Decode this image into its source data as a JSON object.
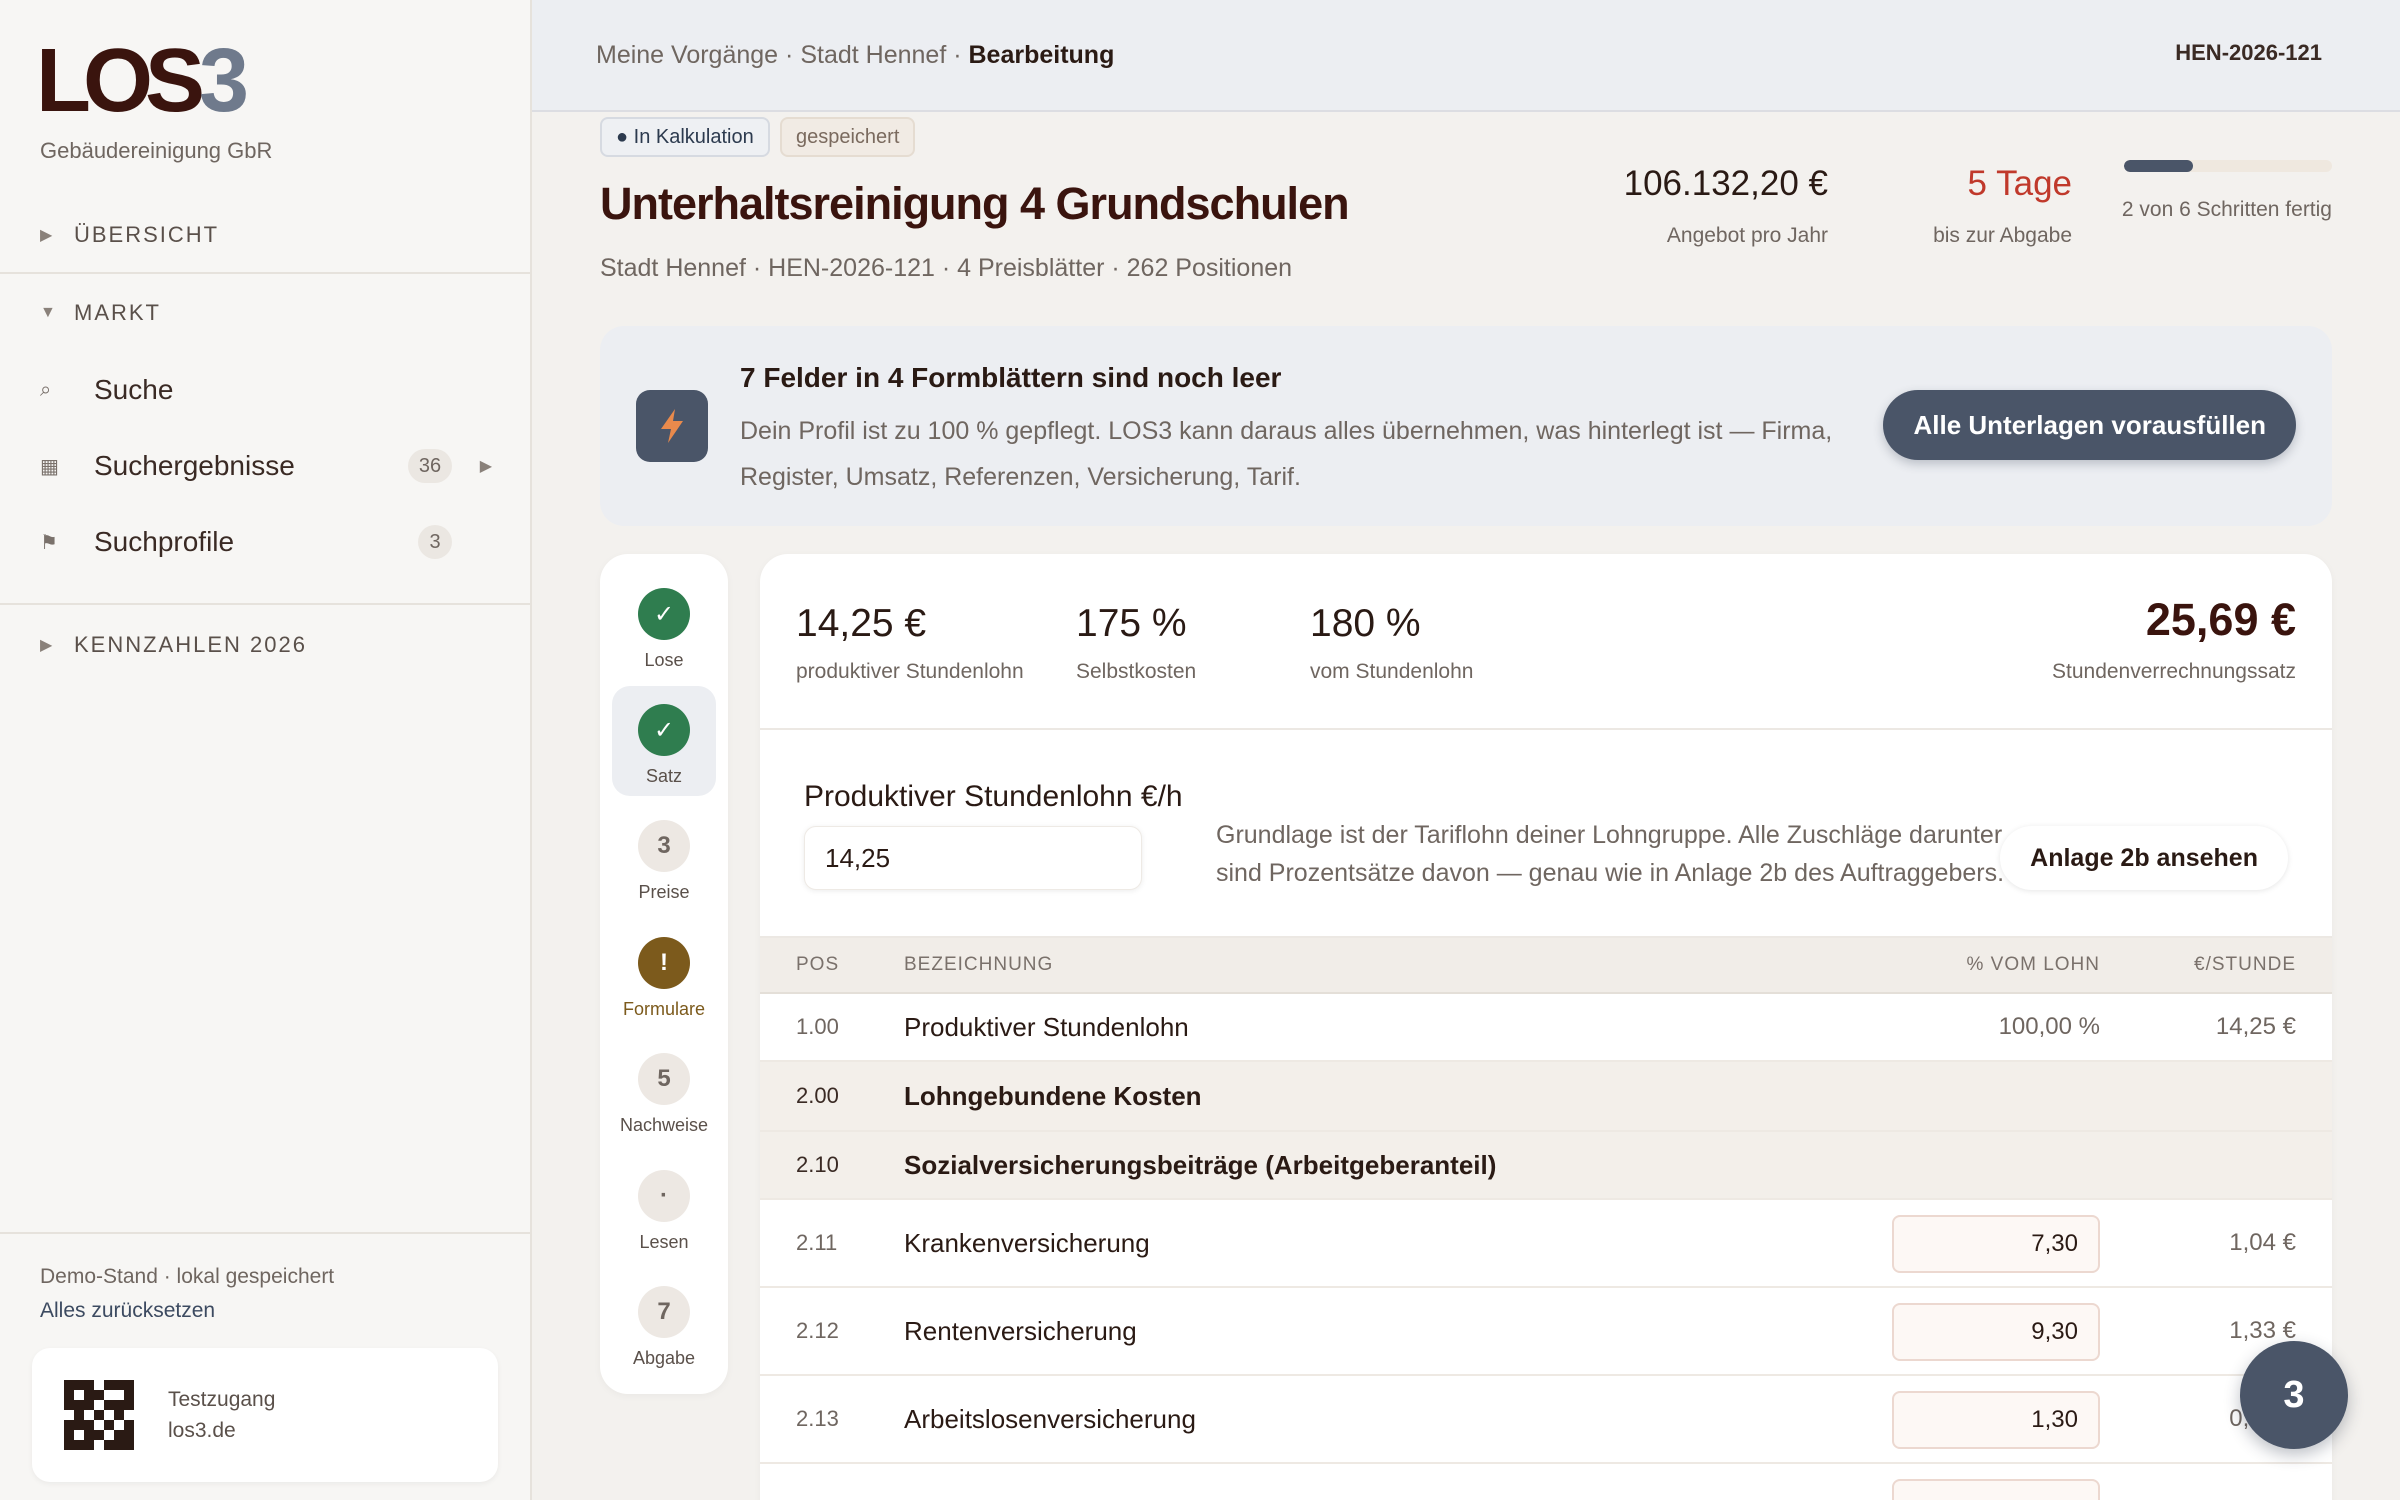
{
  "sidebar": {
    "logo_main": "LOS",
    "logo_digit": "3",
    "company": "Gebäudereinigung GbR",
    "sections": [
      {
        "label": "ÜBERSICHT"
      },
      {
        "label": "MARKT"
      },
      {
        "label": "KENNZAHLEN 2026"
      }
    ],
    "items": [
      {
        "label": "Suche",
        "icon": "search-icon"
      },
      {
        "label": "Suchergebnisse",
        "icon": "grid-icon",
        "badge": "36"
      },
      {
        "label": "Suchprofile",
        "icon": "flag-icon",
        "badge": "3"
      }
    ],
    "demo_status": "Demo-Stand · lokal gespeichert",
    "reset_label": "Alles zurücksetzen",
    "test_label": "Testzugang",
    "test_url": "los3.de"
  },
  "topbar": {
    "crumb_1": "Meine Vorgänge",
    "crumb_2": "Stadt Hennef",
    "crumb_current": "Bearbeitung",
    "separator": "·",
    "case_id": "HEN-2026-121"
  },
  "header": {
    "status_chip": "● In Kalkulation",
    "saved_chip": "gespeichert",
    "title": "Unterhaltsreinigung 4 Grundschulen",
    "subtitle": "Stadt Hennef · HEN-2026-121 · 4 Preisblätter · 262 Positionen",
    "offer_value": "106.132,20 €",
    "offer_label": "Angebot pro Jahr",
    "days_value": "5 Tage",
    "days_label": "bis zur Abgabe",
    "progress_fraction": 0.3333,
    "progress_label": "2 von 6 Schritten fertig"
  },
  "alert": {
    "icon": "lightning-icon",
    "title": "7 Felder in 4 Formblättern sind noch leer",
    "body": "Dein Profil ist zu 100 % gepflegt. LOS3 kann daraus alles übernehmen, was hinterlegt ist — Firma, Register, Umsatz, Referenzen, Versicherung, Tarif.",
    "button": "Alle Unterlagen vorausfüllen"
  },
  "steps": [
    {
      "mark": "✓",
      "label": "Lose",
      "state": "done"
    },
    {
      "mark": "✓",
      "label": "Satz",
      "state": "done-active"
    },
    {
      "mark": "3",
      "label": "Preise",
      "state": "todo"
    },
    {
      "mark": "!",
      "label": "Formulare",
      "state": "warn"
    },
    {
      "mark": "5",
      "label": "Nachweise",
      "state": "todo"
    },
    {
      "mark": "·",
      "label": "Lesen",
      "state": "todo"
    },
    {
      "mark": "7",
      "label": "Abgabe",
      "state": "todo"
    }
  ],
  "summary": {
    "wage_value": "14,25 €",
    "wage_label": "produktiver Stundenlohn",
    "cost_value": "175 %",
    "cost_label": "Selbstkosten",
    "share_value": "180 %",
    "share_label": "vom Stundenlohn",
    "rate_value": "25,69 €",
    "rate_label": "Stundenverrechnungssatz"
  },
  "wage_field": {
    "label": "Produktiver Stundenlohn €/h",
    "value": "14,25",
    "help": "Grundlage ist der Tariflohn deiner Lohngruppe. Alle Zuschläge darunter sind Prozentsätze davon — genau wie in Anlage 2b des Auftraggebers.",
    "button": "Anlage 2b ansehen"
  },
  "table": {
    "headers": {
      "pos": "POS",
      "name": "BEZEICHNUNG",
      "pct": "% VOM LOHN",
      "eur": "€/STUNDE"
    },
    "rows": [
      {
        "pos": "1.00",
        "name": "Produktiver Stundenlohn",
        "pct": "100,00 %",
        "eur": "14,25 €"
      },
      {
        "pos": "2.00",
        "name": "Lohngebundene Kosten",
        "pct": "",
        "eur": ""
      },
      {
        "pos": "2.10",
        "name": "Sozialversicherungsbeiträge (Arbeitgeberanteil)",
        "pct": "",
        "eur": ""
      },
      {
        "pos": "2.11",
        "name": "Krankenversicherung",
        "pct": "7,30",
        "eur": "1,04 €"
      },
      {
        "pos": "2.12",
        "name": "Rentenversicherung",
        "pct": "9,30",
        "eur": "1,33 €"
      },
      {
        "pos": "2.13",
        "name": "Arbeitslosenversicherung",
        "pct": "1,30",
        "eur": "0,19 €"
      }
    ]
  },
  "fab": {
    "label": "3"
  },
  "colors": {
    "accent": "#4a5568",
    "danger": "#c0392b",
    "success": "#2f7d4f",
    "warning": "#7c5a1c",
    "brand": "#3a140e"
  }
}
